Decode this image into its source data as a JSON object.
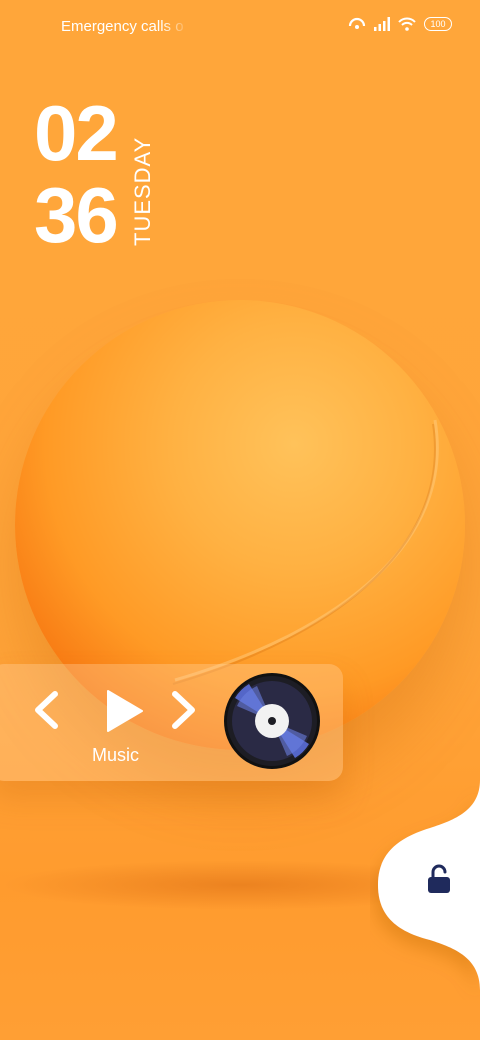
{
  "status_bar": {
    "carrier_text": "Emergency calls o",
    "battery_level": "100",
    "icons": [
      "hotspot-icon",
      "signal-icon",
      "wifi-icon",
      "battery-icon"
    ]
  },
  "clock": {
    "hour": "02",
    "minute": "36",
    "day": "TUESDAY"
  },
  "music_widget": {
    "label": "Music",
    "controls": [
      "previous-icon",
      "play-icon",
      "next-icon"
    ],
    "disc_icon": "vinyl-disc-icon"
  },
  "unlock": {
    "icon": "unlocked-padlock-icon",
    "color": "#1f2a5c"
  },
  "colors": {
    "background": "#ffa63a",
    "ball": "#ff9a25"
  }
}
